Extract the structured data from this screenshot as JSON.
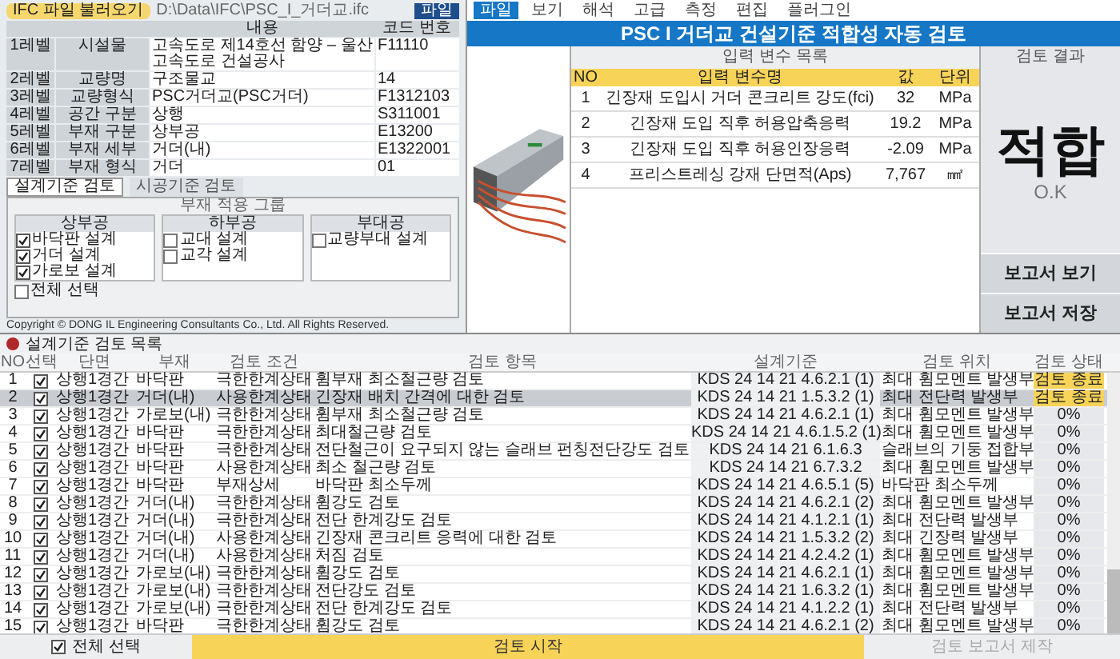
{
  "menu": [
    {
      "label": "파일",
      "selected": true
    },
    {
      "label": "보기",
      "selected": false
    },
    {
      "label": "해석",
      "selected": false
    },
    {
      "label": "고급",
      "selected": false
    },
    {
      "label": "측정",
      "selected": false
    },
    {
      "label": "편집",
      "selected": false
    },
    {
      "label": "플러그인",
      "selected": false
    }
  ],
  "app_title": "PSC I 거더교 건설기준 적합성 자동 검토",
  "info_panel": {
    "file_button": "IFC 파일 불러오기",
    "file_path": "D:\\Data\\IFC\\PSC_I_거더교.ifc",
    "open_button": "파일",
    "columns": [
      "내용",
      "코드 번호"
    ],
    "rows": [
      {
        "level": "1레벨",
        "name": "시설물",
        "value": "고속도로 제14호선 함양 – 울산 고속도로 건설공사",
        "code": "F11110"
      },
      {
        "level": "2레벨",
        "name": "교량명",
        "value": "구조물교",
        "code": "14"
      },
      {
        "level": "3레벨",
        "name": "교량형식",
        "value": "PSC거더교(PSC거더)",
        "code": "F1312103"
      },
      {
        "level": "4레벨",
        "name": "공간 구분",
        "value": "상행",
        "code": "S311001"
      },
      {
        "level": "5레벨",
        "name": "부재 구분",
        "value": "상부공",
        "code": "E13200"
      },
      {
        "level": "6레벨",
        "name": "부재 세부",
        "value": "거더(내)",
        "code": "E1322001"
      },
      {
        "level": "7레벨",
        "name": "부재 형식",
        "value": "거더",
        "code": "01"
      }
    ],
    "tabs": [
      {
        "label": "설계기준 검토",
        "selected": true
      },
      {
        "label": "시공기준 검토",
        "selected": false
      }
    ],
    "group_title": "부재 적용 그룹",
    "groups": [
      {
        "title": "상부공",
        "items": [
          {
            "label": "바닥판 설계",
            "checked": true
          },
          {
            "label": "거더 설계",
            "checked": true
          },
          {
            "label": "가로보 설계",
            "checked": true
          }
        ]
      },
      {
        "title": "하부공",
        "items": [
          {
            "label": "교대 설계",
            "checked": false
          },
          {
            "label": "교각 설계",
            "checked": false
          }
        ]
      },
      {
        "title": "부대공",
        "items": [
          {
            "label": "교량부대 설계",
            "checked": false
          }
        ]
      }
    ],
    "select_all": {
      "label": "전체 선택",
      "checked": false
    },
    "copyright": "Copyright © DONG IL Engineering Consultants Co., Ltd. All Rights Reserved."
  },
  "input_variables": {
    "title": "입력 변수 목록",
    "columns": [
      "NO",
      "입력 변수명",
      "값",
      "단위"
    ],
    "rows": [
      {
        "no": "1",
        "name": "긴장재 도입시 거더 콘크리트 강도(fci)",
        "value": "32",
        "unit": "MPa"
      },
      {
        "no": "2",
        "name": "긴장재 도입 직후 허용압축응력",
        "value": "19.2",
        "unit": "MPa"
      },
      {
        "no": "3",
        "name": "긴장재 도입 직후 허용인장응력",
        "value": "-2.09",
        "unit": "MPa"
      },
      {
        "no": "4",
        "name": "프리스트레싱 강재 단면적(Aps)",
        "value": "7,767",
        "unit": "㎟"
      }
    ]
  },
  "result": {
    "title": "검토 결과",
    "verdict": "적합",
    "verdict_en": "O.K",
    "buttons": [
      "보고서 보기",
      "보고서 저장"
    ]
  },
  "check_list": {
    "title": "설계기준 검토 목록",
    "columns": [
      "NO",
      "선택",
      "단면",
      "부재",
      "검토 조건",
      "검토 항목",
      "설계기준",
      "검토 위치",
      "검토 상태"
    ],
    "rows": [
      {
        "no": "1",
        "checked": true,
        "section": "상행1경간",
        "member": "바닥판",
        "condition": "극한한계상태",
        "item": "휨부재 최소철근량 검토",
        "standard": "KDS 24 14 21 4.6.2.1 (1)",
        "location": "최대 휨모멘트 발생부",
        "status": "검토 종료",
        "done": true,
        "selected": false
      },
      {
        "no": "2",
        "checked": true,
        "section": "상행1경간",
        "member": "거더(내)",
        "condition": "사용한계상태",
        "item": "긴장재 배치 간격에 대한 검토",
        "standard": "KDS 24 14 21 1.5.3.2 (1)",
        "location": "최대 전단력 발생부",
        "status": "검토 종료",
        "done": true,
        "selected": true
      },
      {
        "no": "3",
        "checked": true,
        "section": "상행1경간",
        "member": "가로보(내)",
        "condition": "극한한계상태",
        "item": "휨부재 최소철근량 검토",
        "standard": "KDS 24 14 21 4.6.2.1 (1)",
        "location": "최대 휨모멘트 발생부",
        "status": "0%",
        "done": false,
        "selected": false
      },
      {
        "no": "4",
        "checked": true,
        "section": "상행1경간",
        "member": "바닥판",
        "condition": "극한한계상태",
        "item": "최대철근량 검토",
        "standard": "KDS 24 14 21 4.6.1.5.2 (1)",
        "location": "최대 휨모멘트 발생부",
        "status": "0%",
        "done": false,
        "selected": false
      },
      {
        "no": "5",
        "checked": true,
        "section": "상행1경간",
        "member": "바닥판",
        "condition": "극한한계상태",
        "item": "전단철근이 요구되지 않는 슬래브 펀칭전단강도 검토",
        "standard": "KDS 24 14 21 6.1.6.3",
        "location": "슬래브의 기둥 접합부",
        "status": "0%",
        "done": false,
        "selected": false
      },
      {
        "no": "6",
        "checked": true,
        "section": "상행1경간",
        "member": "바닥판",
        "condition": "사용한계상태",
        "item": "최소 철근량 검토",
        "standard": "KDS 24 14 21 6.7.3.2",
        "location": "최대 휨모멘트 발생부",
        "status": "0%",
        "done": false,
        "selected": false
      },
      {
        "no": "7",
        "checked": true,
        "section": "상행1경간",
        "member": "바닥판",
        "condition": "부재상세",
        "item": "바닥판 최소두께",
        "standard": "KDS 24 14 21 4.6.5.1 (5)",
        "location": "바닥판 최소두께",
        "status": "0%",
        "done": false,
        "selected": false
      },
      {
        "no": "8",
        "checked": true,
        "section": "상행1경간",
        "member": "거더(내)",
        "condition": "극한한계상태",
        "item": "휨강도 검토",
        "standard": "KDS 24 14 21 4.6.2.1 (2)",
        "location": "최대 휨모멘트 발생부",
        "status": "0%",
        "done": false,
        "selected": false
      },
      {
        "no": "9",
        "checked": true,
        "section": "상행1경간",
        "member": "거더(내)",
        "condition": "극한한계상태",
        "item": "전단 한계강도 검토",
        "standard": "KDS 24 14 21 4.1.2.1 (1)",
        "location": "최대 전단력 발생부",
        "status": "0%",
        "done": false,
        "selected": false
      },
      {
        "no": "10",
        "checked": true,
        "section": "상행1경간",
        "member": "거더(내)",
        "condition": "사용한계상태",
        "item": "긴장재 콘크리트 응력에 대한 검토",
        "standard": "KDS 24 14 21 1.5.3.2 (2)",
        "location": "최대 긴장력 발생부",
        "status": "0%",
        "done": false,
        "selected": false
      },
      {
        "no": "11",
        "checked": true,
        "section": "상행1경간",
        "member": "거더(내)",
        "condition": "사용한계상태",
        "item": "처짐 검토",
        "standard": "KDS 24 14 21 4.2.4.2 (1)",
        "location": "최대 휨모멘트 발생부",
        "status": "0%",
        "done": false,
        "selected": false
      },
      {
        "no": "12",
        "checked": true,
        "section": "상행1경간",
        "member": "가로보(내)",
        "condition": "극한한계상태",
        "item": "휨강도 검토",
        "standard": "KDS 24 14 21 4.6.2.1 (1)",
        "location": "최대 휨모멘트 발생부",
        "status": "0%",
        "done": false,
        "selected": false
      },
      {
        "no": "13",
        "checked": true,
        "section": "상행1경간",
        "member": "가로보(내)",
        "condition": "극한한계상태",
        "item": "전단강도 검토",
        "standard": "KDS 24 14 21 1.6.3.2 (1)",
        "location": "최대 휨모멘트 발생부",
        "status": "0%",
        "done": false,
        "selected": false
      },
      {
        "no": "14",
        "checked": true,
        "section": "상행1경간",
        "member": "가로보(내)",
        "condition": "극한한계상태",
        "item": "전단 한계강도 검토",
        "standard": "KDS 24 14 21 4.1.2.2 (1)",
        "location": "최대 전단력 발생부",
        "status": "0%",
        "done": false,
        "selected": false
      },
      {
        "no": "15",
        "checked": true,
        "section": "상행1경간",
        "member": "바닥판",
        "condition": "극한한계상태",
        "item": "휨강도 검토",
        "standard": "KDS 24 14 21 4.6.2.1 (2)",
        "location": "최대 휨모멘트 발생부",
        "status": "0%",
        "done": false,
        "selected": false
      }
    ],
    "select_all": {
      "label": "전체 선택",
      "checked": true
    },
    "start_button": "검토 시작",
    "report_button": {
      "label": "검토 보고서 제작",
      "disabled": true
    }
  }
}
